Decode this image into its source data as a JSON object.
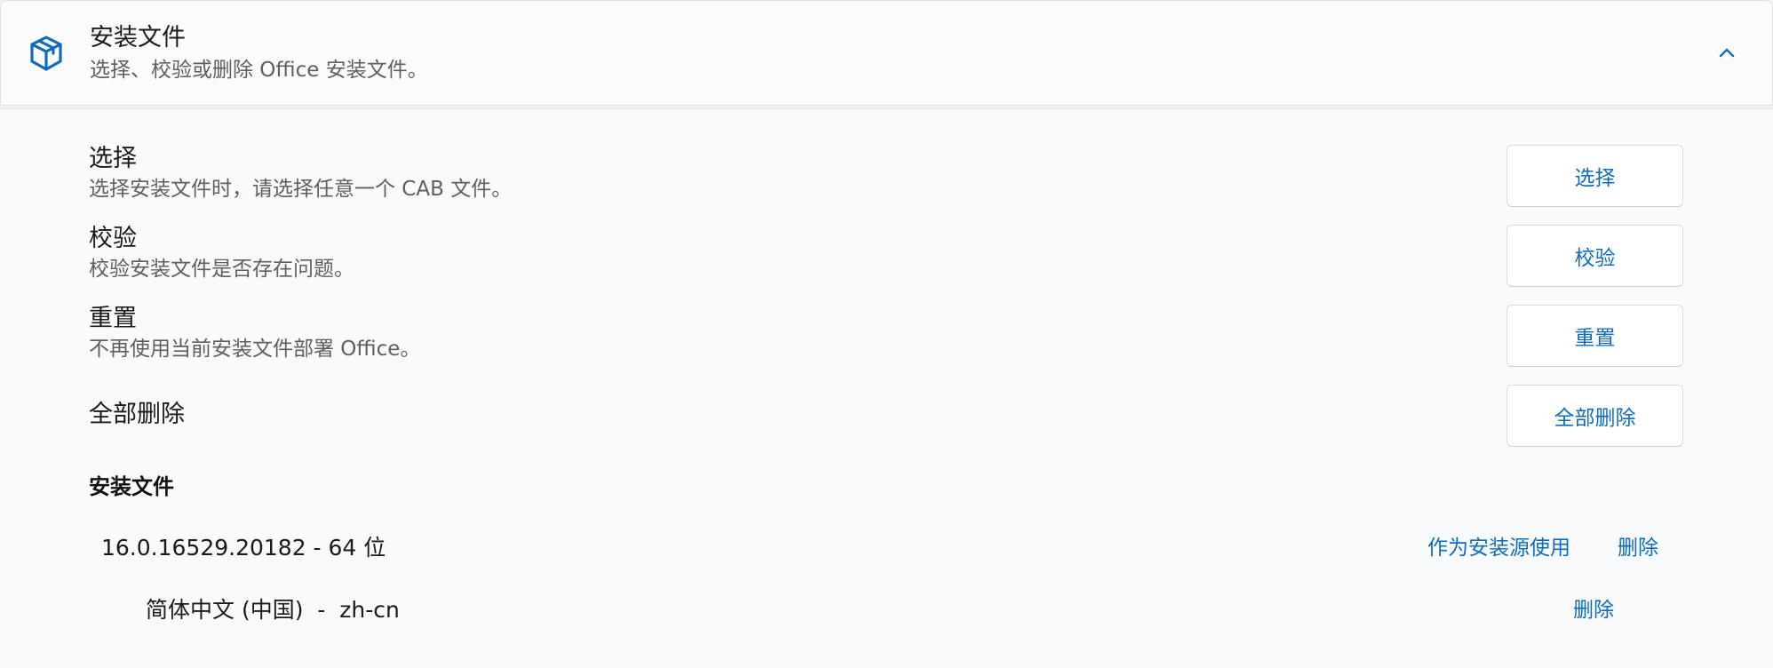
{
  "header": {
    "icon": "package-box-icon",
    "title": "安装文件",
    "subtitle": "选择、校验或删除 Office 安装文件。",
    "collapse_icon": "chevron-up-icon"
  },
  "settings": [
    {
      "title": "选择",
      "description": "选择安装文件时，请选择任意一个 CAB 文件。",
      "button": "选择"
    },
    {
      "title": "校验",
      "description": "校验安装文件是否存在问题。",
      "button": "校验"
    },
    {
      "title": "重置",
      "description": "不再使用当前安装文件部署 Office。",
      "button": "重置"
    },
    {
      "title": "全部删除",
      "description": "",
      "button": "全部删除"
    }
  ],
  "files_section": {
    "heading": "安装文件",
    "version": "16.0.16529.20182 - 64 位",
    "use_as_source_link": "作为安装源使用",
    "delete_link": "删除",
    "languages": [
      {
        "label": "简体中文 (中国)  -  zh-cn",
        "delete_link": "删除"
      }
    ]
  },
  "colors": {
    "accent": "#0f6cbd",
    "icon_blue": "#0f6cbd"
  }
}
